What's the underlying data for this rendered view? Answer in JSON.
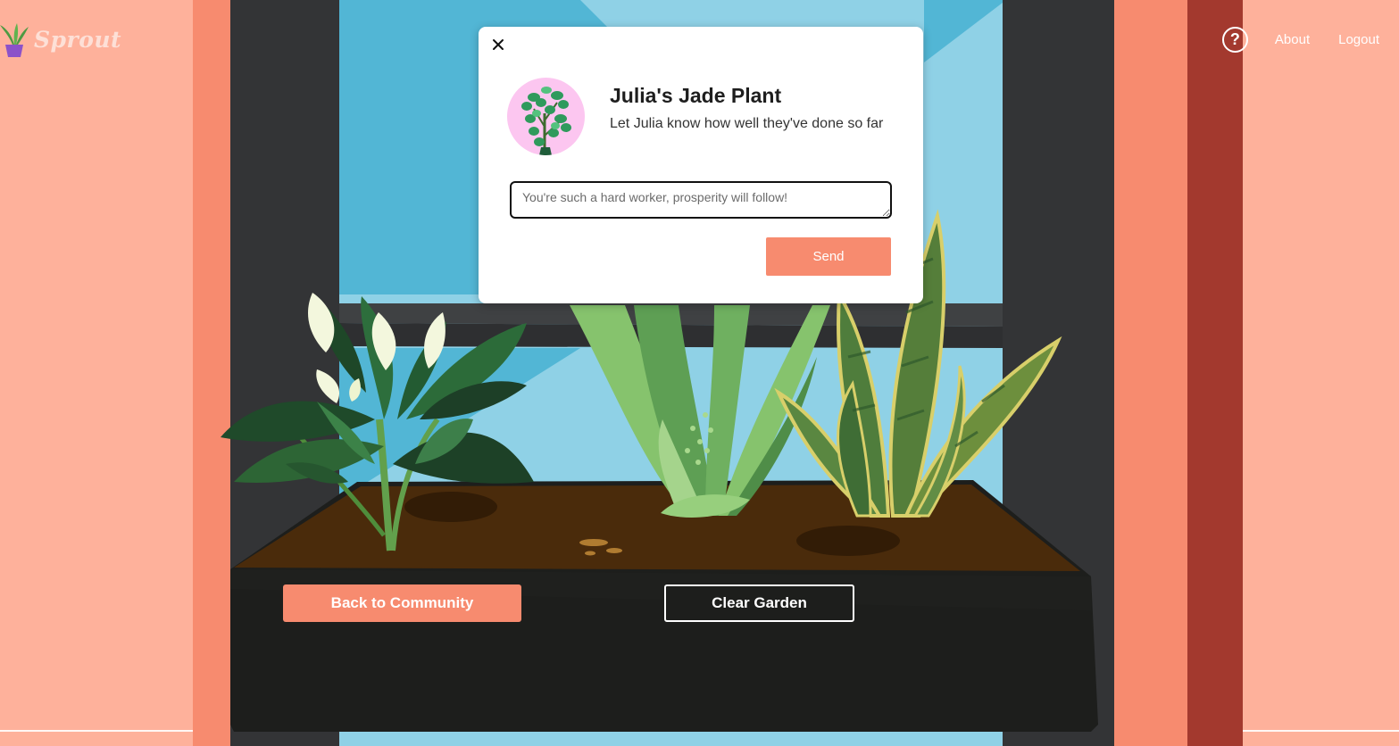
{
  "app": {
    "name": "Sprout"
  },
  "nav": {
    "help_symbol": "?",
    "about": "About",
    "logout": "Logout"
  },
  "modal": {
    "title": "Julia's Jade Plant",
    "subtitle": "Let Julia know how well they've done so far",
    "input_placeholder": "You're such a hard worker, prosperity will follow!",
    "input_value": "",
    "send_label": "Send"
  },
  "actions": {
    "back_label": "Back to Community",
    "clear_label": "Clear Garden"
  },
  "colors": {
    "accent": "#f78b6f",
    "wall": "#feb19b",
    "curtain_dark": "#a3392e",
    "window_frame": "#333436",
    "sky": "#8fd1e6",
    "planter": "#1d1e1c",
    "soil": "#4a2b0b"
  },
  "icons": {
    "logo": "potted-plant-icon",
    "help": "question-circle-icon",
    "close": "close-icon",
    "avatar": "jade-plant-icon"
  }
}
